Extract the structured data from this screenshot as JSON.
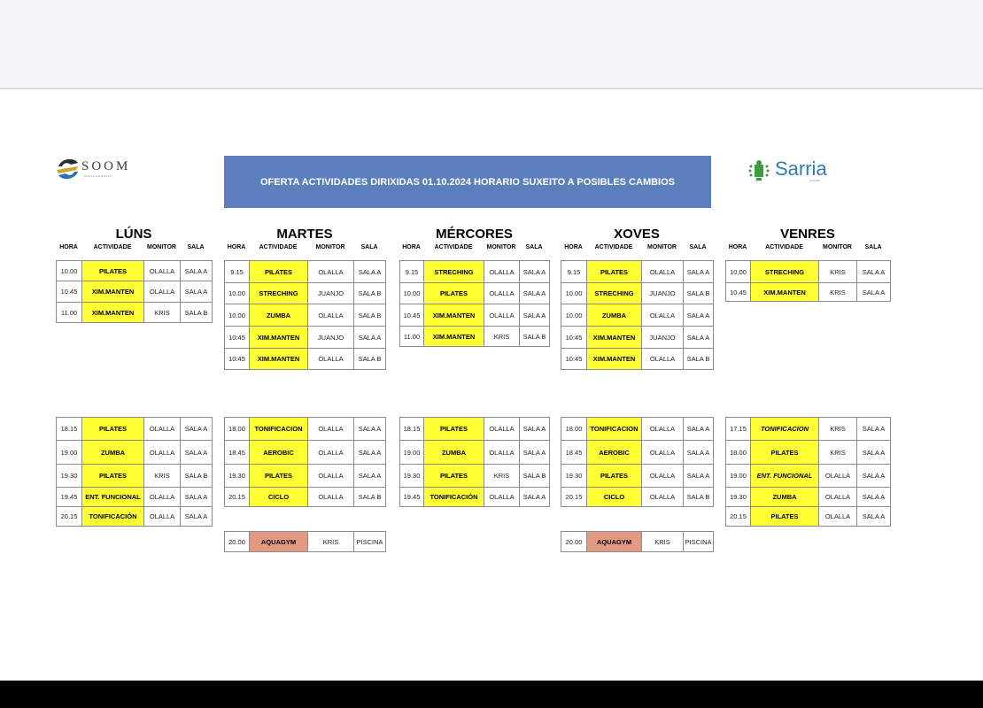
{
  "banner": "OFERTA ACTIVIDADES DIRIXIDAS 01.10.2024 HORARIO SUXEITO A POSIBLES CAMBIOS",
  "logos": {
    "left_text": "SOOM",
    "left_sub": "MANAGEMENT",
    "right_text": "Sarria",
    "right_sub": "Concello"
  },
  "headers": {
    "hora": "HORA",
    "actividade": "ACTIVIDADE",
    "monitor": "MONITOR",
    "sala": "SALA"
  },
  "colors": {
    "activity_bg": "#ffff33",
    "aquagym_bg": "#e39a83",
    "banner_bg": "#5b7fbd"
  },
  "days": [
    {
      "name": "LÚNS",
      "morning": [
        {
          "hora": "10.00",
          "act": "PILATES",
          "mon": "OLALLA",
          "sala": "SALA A"
        },
        {
          "hora": "10.45",
          "act": "XIM.MANTEN",
          "mon": "OLALLA",
          "sala": "SALA A"
        },
        {
          "hora": "11.00",
          "act": "XIM.MANTEN",
          "mon": "KRIS",
          "sala": "SALA B"
        }
      ],
      "evening": [
        {
          "hora": "18.15",
          "act": "PILATES",
          "mon": "OLALLA",
          "sala": "SALA A"
        },
        {
          "hora": "19.00",
          "act": "ZUMBA",
          "mon": "OLALLA",
          "sala": "SALA A"
        },
        {
          "hora": "19.30",
          "act": "PILATES",
          "mon": "KRIS",
          "sala": "SALA B"
        },
        {
          "hora": "19.45",
          "act": "ENT. FUNCIONAL",
          "mon": "OLALLA",
          "sala": "SALA A"
        },
        {
          "hora": "20.15",
          "act": "TONIFICACIÓN",
          "mon": "OLALLA",
          "sala": "SALA A"
        }
      ]
    },
    {
      "name": "MARTES",
      "morning": [
        {
          "hora": "9.15",
          "act": "PILATES",
          "mon": "OLALLA",
          "sala": "SALA A"
        },
        {
          "hora": "10.00",
          "act": "STRECHING",
          "mon": "JUANJO",
          "sala": "SALA B"
        },
        {
          "hora": "10.00",
          "act": "ZUMBA",
          "mon": "OLALLA",
          "sala": "SALA B"
        },
        {
          "hora": "10:45",
          "act": "XIM.MANTEN",
          "mon": "JUANJO",
          "sala": "SALA A"
        },
        {
          "hora": "10:45",
          "act": "XIM.MANTEN",
          "mon": "OLALLA",
          "sala": "SALA B"
        }
      ],
      "evening": [
        {
          "hora": "18.00",
          "act": "TONIFICACION",
          "mon": "OLALLA",
          "sala": "SALA A"
        },
        {
          "hora": "18.45",
          "act": "AEROBIC",
          "mon": "OLALLA",
          "sala": "SALA A"
        },
        {
          "hora": "19.30",
          "act": "PILATES",
          "mon": "OLALLA",
          "sala": "SALA A"
        },
        {
          "hora": "20.15",
          "act": "CICLO",
          "mon": "OLALLA",
          "sala": "SALA B"
        }
      ],
      "extra": {
        "hora": "20.00",
        "act": "AQUAGYM",
        "mon": "KRIS",
        "sala": "PISCINA"
      }
    },
    {
      "name": "MÉRCORES",
      "morning": [
        {
          "hora": "9.15",
          "act": "STRECHING",
          "mon": "OLALLA",
          "sala": "SALA A"
        },
        {
          "hora": "10.00",
          "act": "PILATES",
          "mon": "OLALLA",
          "sala": "SALA A"
        },
        {
          "hora": "10.45",
          "act": "XIM.MANTEN",
          "mon": "OLALLA",
          "sala": "SALA A"
        },
        {
          "hora": "11.00",
          "act": "XIM.MANTEN",
          "mon": "KRIS",
          "sala": "SALA B"
        }
      ],
      "evening": [
        {
          "hora": "18.15",
          "act": "PILATES",
          "mon": "OLALLA",
          "sala": "SALA A"
        },
        {
          "hora": "19.00",
          "act": "ZUMBA",
          "mon": "OLALLA",
          "sala": "SALA A"
        },
        {
          "hora": "19.30",
          "act": "PILATES",
          "mon": "KRIS",
          "sala": "SALA B"
        },
        {
          "hora": "19.45",
          "act": "TONIFICACIÓN",
          "mon": "OLALLA",
          "sala": "SALA A"
        }
      ]
    },
    {
      "name": "XOVES",
      "morning": [
        {
          "hora": "9.15",
          "act": "PILATES",
          "mon": "OLALLA",
          "sala": "SALA A"
        },
        {
          "hora": "10.00",
          "act": "STRECHING",
          "mon": "JUANJO",
          "sala": "SALA B"
        },
        {
          "hora": "10.00",
          "act": "ZUMBA",
          "mon": "OLALLA",
          "sala": "SALA A"
        },
        {
          "hora": "10:45",
          "act": "XIM.MANTEN",
          "mon": "JUANJO",
          "sala": "SALA A"
        },
        {
          "hora": "10:45",
          "act": "XIM.MANTEN",
          "mon": "OLALLA",
          "sala": "SALA B"
        }
      ],
      "evening": [
        {
          "hora": "18.00",
          "act": "TONIFICACION",
          "mon": "OLALLA",
          "sala": "SALA A"
        },
        {
          "hora": "18.45",
          "act": "AEROBIC",
          "mon": "OLALLA",
          "sala": "SALA A"
        },
        {
          "hora": "19.30",
          "act": "PILATES",
          "mon": "OLALLA",
          "sala": "SALA A"
        },
        {
          "hora": "20.15",
          "act": "CICLO",
          "mon": "OLALLA",
          "sala": "SALA B"
        }
      ],
      "extra": {
        "hora": "20.00",
        "act": "AQUAGYM",
        "mon": "KRIS",
        "sala": "PISCINA"
      }
    },
    {
      "name": "VENRES",
      "morning": [
        {
          "hora": "10.00",
          "act": "STRECHING",
          "mon": "KRIS",
          "sala": "SALA A"
        },
        {
          "hora": "10.45",
          "act": "XIM.MANTEN",
          "mon": "KRIS",
          "sala": "SALA A"
        }
      ],
      "evening": [
        {
          "hora": "17.15",
          "act": "TONIFICACION",
          "mon": "KRIS",
          "sala": "SALA A",
          "italic": true
        },
        {
          "hora": "18.00",
          "act": "PILATES",
          "mon": "KRIS",
          "sala": "SALA A"
        },
        {
          "hora": "19.00",
          "act": "ENT. FUNCIONAL",
          "mon": "OLALLA",
          "sala": "SALA A",
          "italic": true
        },
        {
          "hora": "19.30",
          "act": "ZUMBA",
          "mon": "OLALLA",
          "sala": "SALA A"
        },
        {
          "hora": "20.15",
          "act": "PILATES",
          "mon": "OLALLA",
          "sala": "SALA A"
        }
      ]
    }
  ]
}
